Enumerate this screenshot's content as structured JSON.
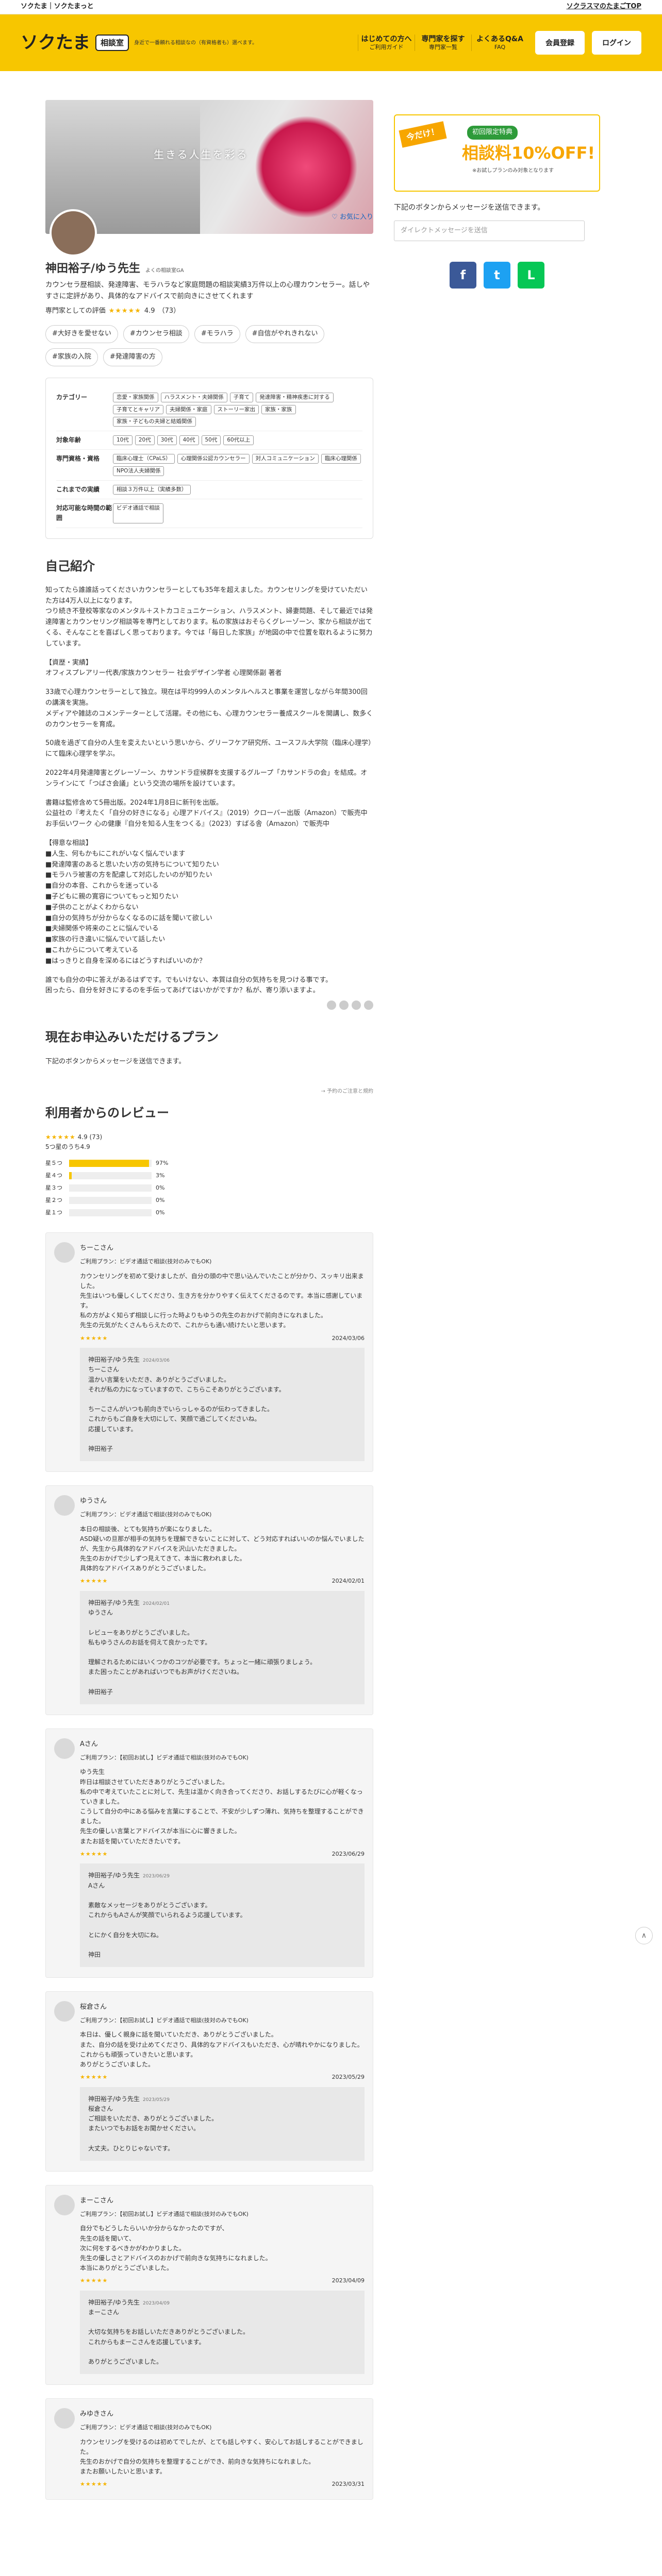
{
  "topbar": {
    "brand": "ソクたま｜ソクたまっと",
    "link": "ソクラスマのたまごTOP"
  },
  "header": {
    "logo": "ソクたま",
    "logo_box": "相談室",
    "logo_sub": "身近で一番頼れる相談なの（有資格者も）選べます。",
    "nav": [
      {
        "label": "はじめての方へ",
        "sub": "ご利用ガイド"
      },
      {
        "label": "専門家を探す",
        "sub": "専門家一覧"
      },
      {
        "label": "よくあるQ&A",
        "sub": "FAQ"
      }
    ],
    "btn1": "会員登録",
    "btn2": "ログイン"
  },
  "profile": {
    "hero_caption": "生きる人生を彩る",
    "name": "神田裕子/ゆう先生",
    "name_sub": "よくの相談室GA",
    "bio": "カウンセラ歴相談、発達障害、モラハラなど家庭問題の相談実績3万件以上の心理カウンセラー。話しやすさに定評があり、具体的なアドバイスで前向きにさせてくれます",
    "rating_label": "専門家としての評価",
    "rating": "4.9",
    "rating_count": "（73）",
    "fav": "お気に入り",
    "tags": [
      "#大好きを愛せない",
      "#カウンセラ相談",
      "#モラハラ",
      "#自信がやれきれない",
      "#家族の入院",
      "#発達障害の方"
    ]
  },
  "info": [
    {
      "label": "カテゴリー",
      "vals": [
        "恋愛・家族関係",
        "ハラスメント・夫婦関係",
        "子育て",
        "発達障害・精神疾患に対する",
        "子育てとキャリア",
        "夫婦関係・家庭",
        "ストーリー家出",
        "家族・家族",
        " 家族・子どもの夫婦と結婚関係"
      ]
    },
    {
      "label": "対象年齢",
      "vals": [
        "10代",
        "20代",
        "30代",
        "40代",
        "50代",
        "60代以上"
      ]
    },
    {
      "label": "専門資格・資格",
      "vals": [
        "臨床心理士（CPaLS）",
        "心理関係公認カウンセラー",
        "対人コミュニケーション",
        "臨床心理関係",
        "NPO法人夫婦関係"
      ]
    },
    {
      "label": "これまでの実績",
      "vals": [
        "相談３万件以上（実績多数）"
      ]
    },
    {
      "label": "対応可能な時間の範囲",
      "vals": [
        "ビデオ通話で相談"
      ]
    }
  ],
  "intro": {
    "title": "自己紹介",
    "paras": [
      "知ってたら誰誰話ってくださいカウンセラーとしても35年を超えました。カウンセリングを受けていただいた方は4万人以上になります。\nつり続き不登校等家なのメンタル＋ストカコミュニケーション、ハラスメント、婦妻問題、そして最近では発達障害とカウンセリング相談等を専門としております。私の家族はおそらくグレーゾーン、家から相談が出てくる、そんなことを喜ばしく思っております。今では「毎日した家族」が地図の中で位置を取れるように努力しています。",
      "【資歴・実績】\nオフィスプレアリー代表/家族カウンセラー 社会デザイン学者 心理関係副 著者",
      "33歳で心理カウンセラーとして独立。現在は平均999人のメンタルヘルスと事業を運営しながら年間300回の講演を実施。\nメディアや雑誌のコメンテーターとして活躍。その他にも、心理カウンセラー養成スクールを開講し、数多くのカウンセラーを育成。",
      "50歳を過ぎて自分の人生を変えたいという思いから、グリーフケア研究所、ユースフル大学院（臨床心理学）にて臨床心理学を学ぶ。",
      "2022年4月発達障害とグレーゾーン、カサンドラ症候群を支援するグループ「カサンドラの会」を結成。オンラインにて「つばさ会議」という交流の場所を設けています。",
      "書籍は監修含めて5冊出版。2024年1月8日に新刊を出版。\n公益社の『考えたく「自分の好きになる」心理アドバイス』（2019）クローバー出版（Amazon）で販売中\nお手伝いワーク 心の健康『自分を知る人生をつくる』（2023）すばる舎（Amazon）で販売中",
      "【得意な相談】\n■人生、何もかもにこれがいなく悩んでいます\n■発達障害のあると思いたい方の気持ちについて知りたい\n■モラハラ被害の方を配慮して対応したいのが知りたい\n■自分の本音、これからを迷っている\n■子どもに親の寛容についてもっと知りたい\n■子供のことがよくわからない\n■自分の気持ちが分からなくなるのに話を聞いて欲しい\n■夫婦関係や将来のことに悩んでいる\n■家族の行き違いに悩んでいて話したい\n■これからについて考えている\n■はっきりと自身を深めるにはどうすればいいのか？",
      "誰でも自分の中に答えがあるはずです。でもいけない、本質は自分の気持ちを見つける事です。\n困ったら、自分を好きにするのを手伝ってあげてはいかがですか？私が、寄り添いますよ。"
    ]
  },
  "plan": {
    "title": "現在お申込みいただけるプラン",
    "sub": "下記のボタンからメッセージを送信できます。",
    "link": "→ 予約のご注意と規約"
  },
  "reviews_summary": {
    "title": "利用者からのレビュー",
    "avg": "4.9",
    "count": "73",
    "label": "5つ星のうち4.9",
    "rows": [
      {
        "l": "星５つ",
        "p": 0.97,
        "t": "97%"
      },
      {
        "l": "星４つ",
        "p": 0.03,
        "t": "3%"
      },
      {
        "l": "星３つ",
        "p": 0,
        "t": "0%"
      },
      {
        "l": "星２つ",
        "p": 0,
        "t": "0%"
      },
      {
        "l": "星１つ",
        "p": 0,
        "t": "0%"
      }
    ]
  },
  "reviews": [
    {
      "name": "ちーこさん",
      "plan": "ご利用プラン：ビデオ通話で相談(技対のみでもOK)",
      "body": "カウンセリングを初めて受けましたが、自分の頭の中で思い込んでいたことが分かり、スッキリ出来ました。\n先生はいつも優しくしてくださり、生き方を分かりやすく伝えてくださるのです。本当に感謝しています。\n私の方がよく知らず相談しに行った時よりもゆうの先生のおかげで前向きになれました。\n先生の元気がたくさんもらえたので、これからも通い続けたいと思います。",
      "date": "2024/03/06",
      "reply_title": "神田裕子/ゆう先生",
      "reply_date": "2024/03/06",
      "reply": "ちーこさん\n温かい言葉をいただき、ありがとうございました。\nそれが私の力になっていますので、こちらこそありがとうございます。\n\nちーこさんがいつも前向きでいらっしゃるのが伝わってきました。\nこれからもご自身を大切にして、笑顔で過ごしてくださいね。\n応援しています。\n\n神田裕子"
    },
    {
      "name": "ゆうさん",
      "plan": "ご利用プラン：ビデオ通話で相談(技対のみでもOK)",
      "body": "本日の相談後、とても気持ちが楽になりました。\nASD疑いの旦那が相手の気持ちを理解できないことに対して、どう対応すればいいのか悩んでいましたが、先生から具体的なアドバイスを沢山いただきました。\n先生のおかげで少しずつ見えてきて、本当に救われました。\n具体的なアドバイスありがとうございました。",
      "date": "2024/02/01",
      "reply_title": "神田裕子/ゆう先生",
      "reply_date": "2024/02/01",
      "reply": "ゆうさん\n\nレビューをありがとうございました。\n私もゆうさんのお話を伺えて良かったです。\n\n理解されるためにはいくつかのコツが必要です。ちょっと一緒に頑張りましょう。\nまた困ったことがあればいつでもお声がけくださいね。\n\n神田裕子"
    },
    {
      "name": "Aさん",
      "plan": "ご利用プラン：【初回お試し】ビデオ通話で相談(技対のみでもOK)",
      "body": "ゆう先生\n昨日は相談させていただきありがとうございました。\n私の中で考えていたことに対して、先生は温かく向き合ってくださり、お話しするたびに心が軽くなっていきました。\nこうして自分の中にある悩みを言葉にすることで、不安が少しずつ薄れ、気持ちを整理することができました。\n先生の優しい言葉とアドバイスが本当に心に響きました。\nまたお話を聞いていただきたいです。",
      "date": "2023/06/29",
      "reply_title": "神田裕子/ゆう先生",
      "reply_date": "2023/06/29",
      "reply": "Aさん\n\n素敵なメッセージをありがとうございます。\nこれからもAさんが笑顔でいられるよう応援しています。\n\nとにかく自分を大切にね。\n\n神田"
    },
    {
      "name": "桜倉さん",
      "plan": "ご利用プラン：【初回お試し】ビデオ通話で相談(技対のみでもOK)",
      "body": "本日は、優しく親身に話を聞いていただき、ありがとうございました。\nまた、自分の話を受け止めてくださり、具体的なアドバイスもいただき、心が晴れやかになりました。\nこれからも頑張っていきたいと思います。\nありがとうございました。",
      "date": "2023/05/29",
      "reply_title": "神田裕子/ゆう先生",
      "reply_date": "2023/05/29",
      "reply": "桜倉さん\nご相談をいただき、ありがとうございました。\nまたいつでもお話をお聞かせください。\n\n大丈夫。ひとりじゃないです。"
    },
    {
      "name": "まーこさん",
      "plan": "ご利用プラン：【初回お試し】ビデオ通話で相談(技対のみでもOK)",
      "body": "自分でもどうしたらいいか分からなかったのですが、\n先生の話を聞いて、\n次に何をするべきかがわかりました。\n先生の優しさとアドバイスのおかげで前向きな気持ちになれました。\n本当にありがとうございました。",
      "date": "2023/04/09",
      "reply_title": "神田裕子/ゆう先生",
      "reply_date": "2023/04/09",
      "reply": "まーこさん\n\n大切な気持ちをお話しいただきありがとうございました。\nこれからもまーこさんを応援しています。\n\nありがとうございました。"
    },
    {
      "name": "みゆきさん",
      "plan": "ご利用プラン：ビデオ通話で相談(技対のみでもOK)",
      "body": "カウンセリングを受けるのは初めてでしたが、とても話しやすく、安心してお話しすることができました。\n先生のおかげで自分の気持ちを整理することができ、前向きな気持ちになれました。\nまたお願いしたいと思います。",
      "date": "2023/03/31",
      "reply_title": "",
      "reply_date": "",
      "reply": ""
    }
  ],
  "side": {
    "banner_lt": "今だけ！",
    "banner_t1": "初回限定特典",
    "banner_t2": "相談料10%OFF!",
    "banner_t3": "※お試しプランのみ対象となります",
    "msg": "下記のボタンからメッセージを送信できます。",
    "placeholder": "ダイレクトメッセージを送信",
    "sns": [
      "f",
      "t",
      "L"
    ]
  },
  "colors": {
    "brand": "#f7c600",
    "star": "#f5b400"
  },
  "totop": "∧"
}
